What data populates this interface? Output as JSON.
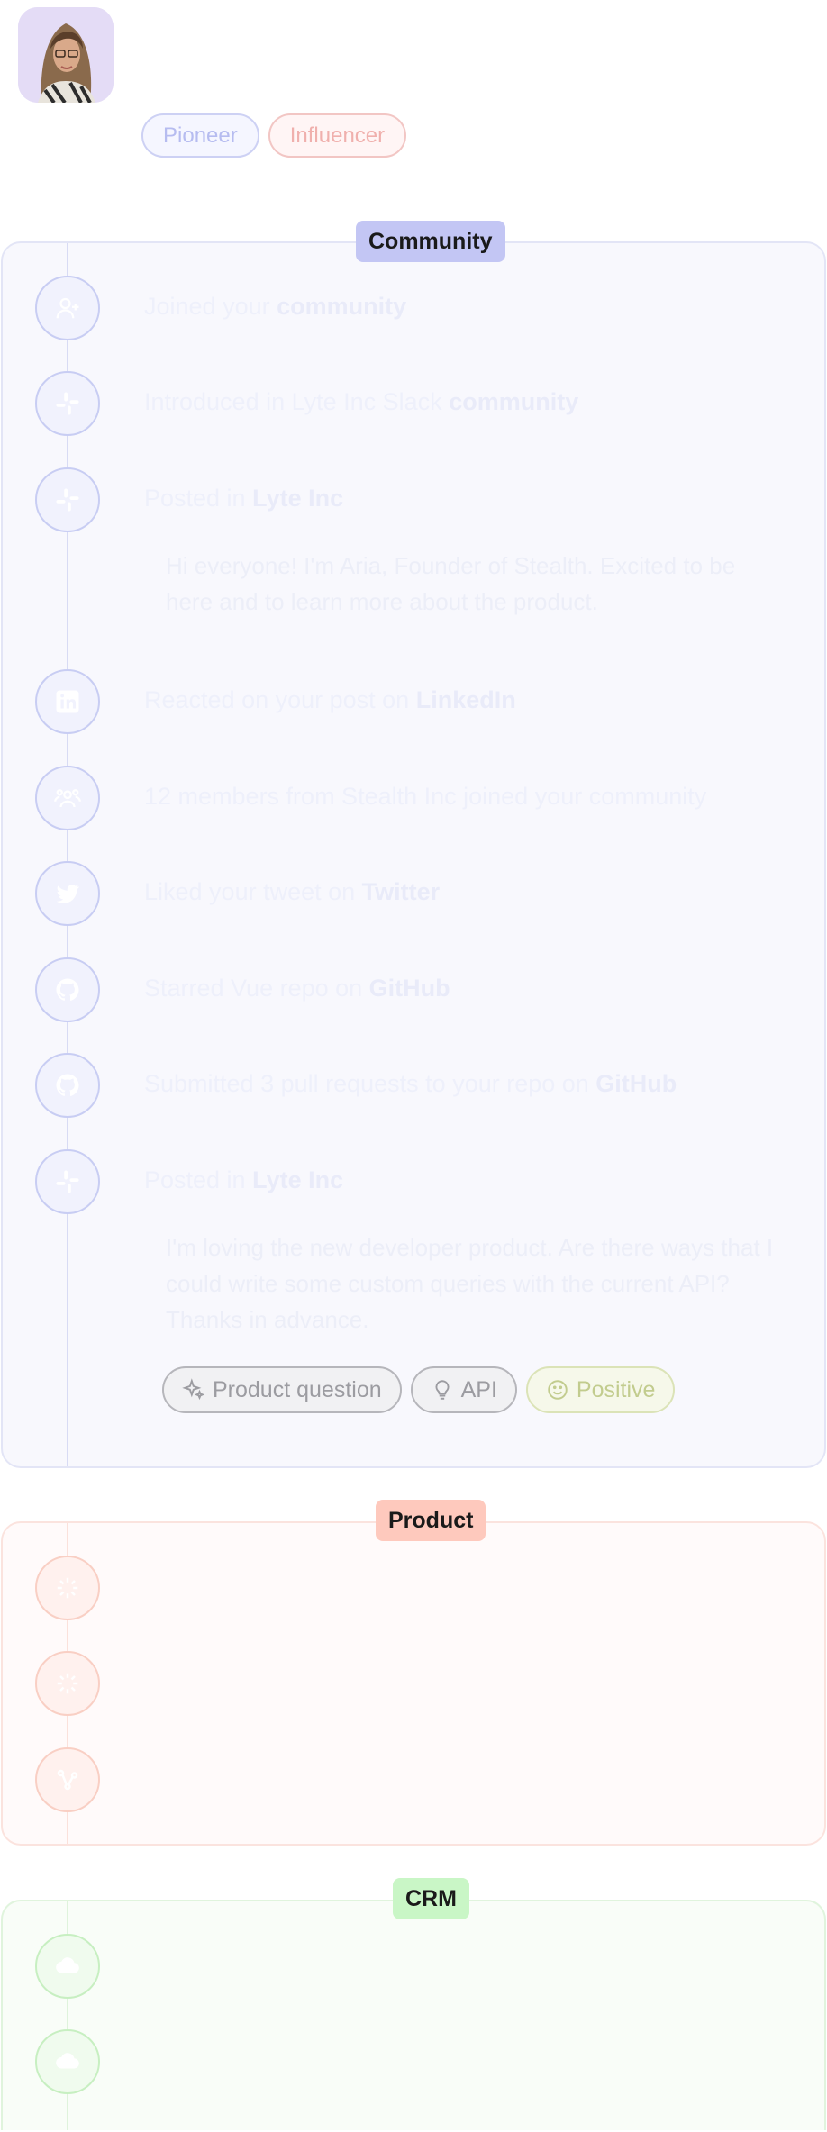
{
  "profile": {
    "badges": [
      "Pioneer",
      "Influencer"
    ]
  },
  "colors": {
    "community": "#c3c6f4",
    "product": "#fec9bd",
    "crm": "#c9f6c6"
  },
  "community": {
    "title": "Community",
    "events": [
      {
        "icon": "user-plus-icon",
        "pre": "Joined your ",
        "bold": "community",
        "post": ""
      },
      {
        "icon": "slack-icon",
        "pre": "Introduced in Lyte Inc Slack ",
        "bold": "community",
        "post": ""
      },
      {
        "icon": "slack-icon",
        "pre": "Posted in ",
        "bold": "Lyte Inc",
        "post": "",
        "quote": "Hi everyone! I'm Aria, Founder of Stealth. Excited to be here and to learn more about the product."
      },
      {
        "icon": "linkedin-icon",
        "pre": "Reacted on your post on ",
        "bold": "LinkedIn",
        "post": ""
      },
      {
        "icon": "users-icon",
        "pre": "12 members from Stealth Inc joined your community",
        "bold": "",
        "post": ""
      },
      {
        "icon": "twitter-icon",
        "pre": "Liked your tweet on ",
        "bold": "Twitter",
        "post": ""
      },
      {
        "icon": "github-icon",
        "pre": "Starred Vue repo on ",
        "bold": "GitHub",
        "post": ""
      },
      {
        "icon": "github-icon",
        "pre": "Submitted 3 pull requests to your repo on ",
        "bold": "GitHub",
        "post": ""
      },
      {
        "icon": "slack-icon",
        "pre": "Posted in ",
        "bold": "Lyte Inc",
        "post": "",
        "quote": "I'm loving the new developer product. Are there ways that I could write some custom queries with the current API? Thanks in advance."
      }
    ],
    "tags": {
      "product_question": "Product question",
      "api": "API",
      "positive": "Positive"
    }
  },
  "product": {
    "title": "Product",
    "events": [
      {
        "icon": "sparkle-icon",
        "text": ""
      },
      {
        "icon": "sparkle-icon",
        "text": ""
      },
      {
        "icon": "flow-icon",
        "text": ""
      }
    ]
  },
  "crm": {
    "title": "CRM",
    "events": [
      {
        "icon": "cloud-icon",
        "text": ""
      },
      {
        "icon": "cloud-icon",
        "text": ""
      }
    ]
  }
}
